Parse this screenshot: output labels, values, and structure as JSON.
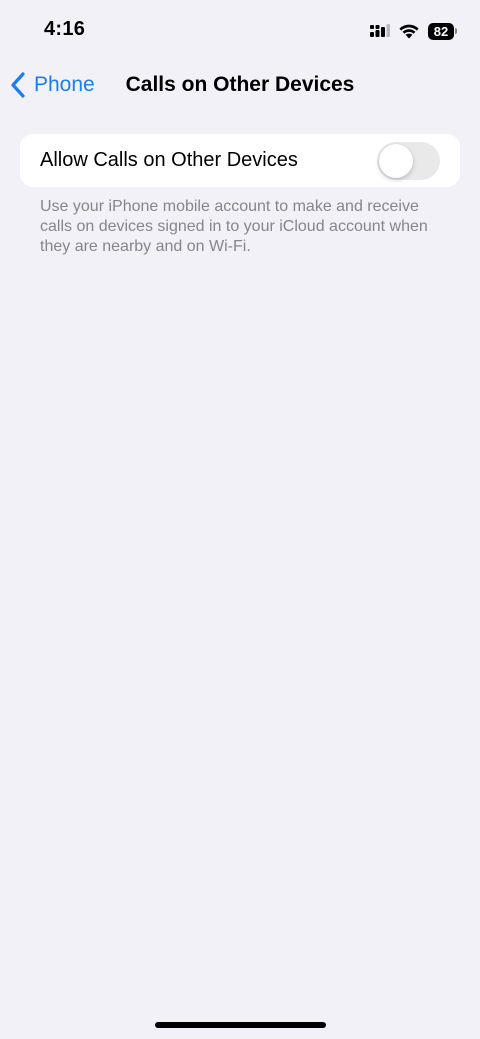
{
  "status_bar": {
    "time": "4:16",
    "battery_level": "82",
    "signal_icon": "cellular-signal-icon",
    "wifi_icon": "wifi-icon",
    "battery_icon": "battery-icon"
  },
  "nav": {
    "back_label": "Phone",
    "back_icon": "chevron-left-icon",
    "title": "Calls on Other Devices"
  },
  "settings": {
    "allow_calls_label": "Allow Calls on Other Devices",
    "allow_calls_enabled": false,
    "footer": "Use your iPhone mobile account to make and receive calls on devices signed in to your iCloud account when they are nearby and on Wi-Fi."
  },
  "colors": {
    "background": "#f2f1f7",
    "accent": "#1a7df0",
    "card": "#ffffff",
    "toggle_off": "#e9e9ea",
    "secondary_text": "#86858b"
  }
}
